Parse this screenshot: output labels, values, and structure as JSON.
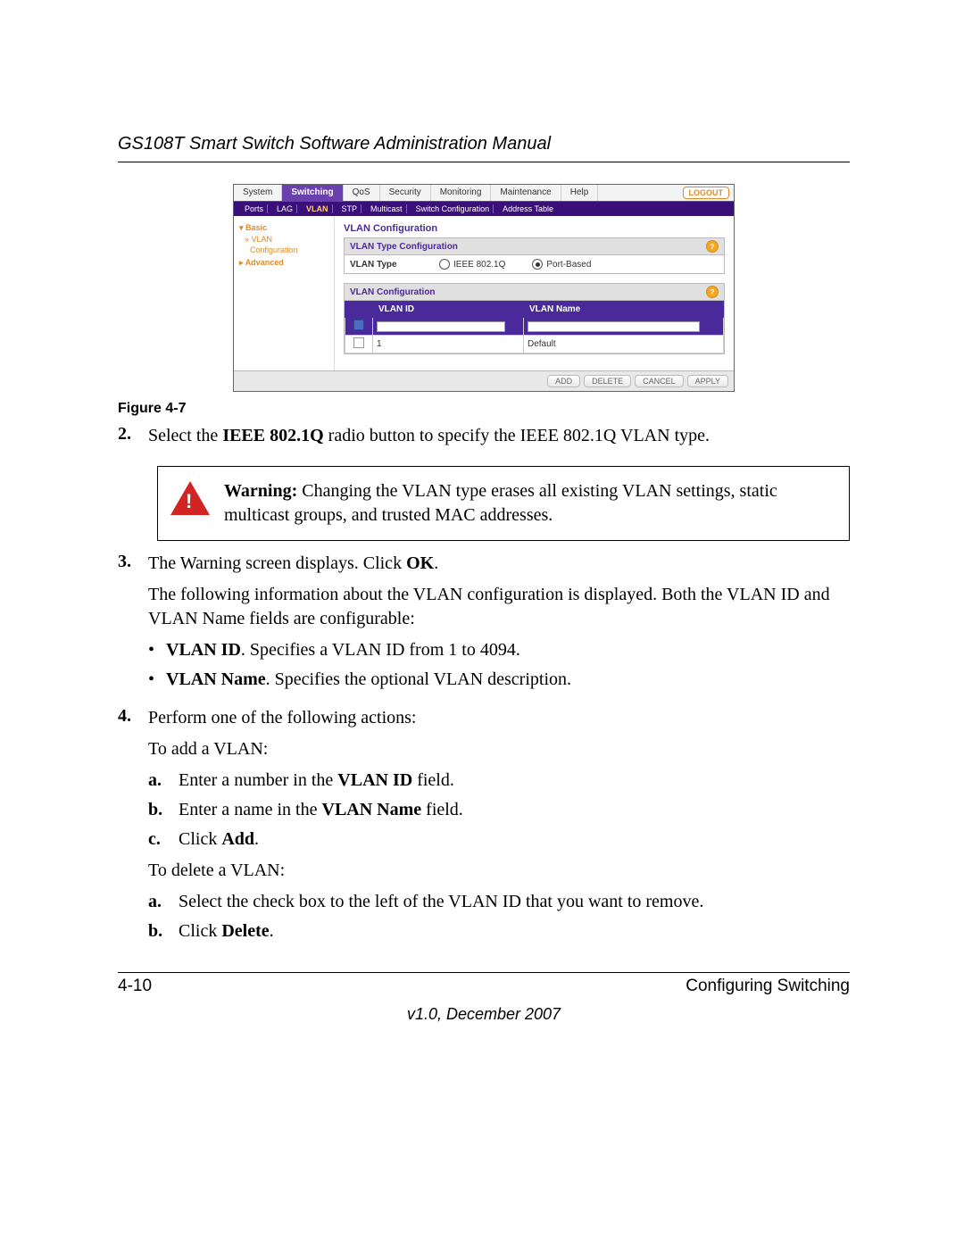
{
  "header": {
    "title": "GS108T Smart Switch Software Administration Manual"
  },
  "figure_caption": "Figure 4-7",
  "ui": {
    "toptabs": [
      "System",
      "Switching",
      "QoS",
      "Security",
      "Monitoring",
      "Maintenance",
      "Help"
    ],
    "toptabs_active_index": 1,
    "logout": "LOGOUT",
    "subtabs": [
      "Ports",
      "LAG",
      "VLAN",
      "STP",
      "Multicast",
      "Switch Configuration",
      "Address Table"
    ],
    "subtabs_active_index": 2,
    "side": {
      "basic": "Basic",
      "vlan": "VLAN",
      "config": "Configuration",
      "advanced": "Advanced"
    },
    "pane_title": "VLAN Configuration",
    "type_box_title": "VLAN Type Configuration",
    "type_label": "VLAN Type",
    "radio_ieee": "IEEE 802.1Q",
    "radio_port": "Port-Based",
    "cfg_box_title": "VLAN Configuration",
    "col_id": "VLAN ID",
    "col_name": "VLAN Name",
    "row_id": "1",
    "row_name": "Default",
    "btn_add": "ADD",
    "btn_delete": "DELETE",
    "btn_cancel": "CANCEL",
    "btn_apply": "APPLY"
  },
  "step2": {
    "num": "2.",
    "prefix": "Select the ",
    "bold": "IEEE 802.1Q",
    "suffix": " radio button to specify the IEEE 802.1Q VLAN type."
  },
  "warning": {
    "label": "Warning:",
    "text": " Changing the VLAN type erases all existing VLAN settings, static multicast groups, and trusted MAC addresses."
  },
  "step3": {
    "num": "3.",
    "line1_prefix": "The Warning screen displays. Click ",
    "line1_bold": "OK",
    "line1_suffix": ".",
    "line2": "The following information about the VLAN configuration is displayed. Both the VLAN ID and VLAN Name fields are configurable:",
    "bullet1_bold": "VLAN ID",
    "bullet1_rest": ". Specifies a VLAN ID from 1 to 4094.",
    "bullet2_bold": "VLAN Name",
    "bullet2_rest": ". Specifies the optional VLAN description."
  },
  "step4": {
    "num": "4.",
    "line1": "Perform one of the following actions:",
    "add_intro": "To add a VLAN:",
    "a": {
      "sn": "a.",
      "prefix": "Enter a number in the ",
      "bold": "VLAN ID",
      "suffix": " field."
    },
    "b": {
      "sn": "b.",
      "prefix": "Enter a name in the ",
      "bold": "VLAN Name",
      "suffix": " field."
    },
    "c": {
      "sn": "c.",
      "prefix": "Click ",
      "bold": "Add",
      "suffix": "."
    },
    "del_intro": "To delete a VLAN:",
    "da": {
      "sn": "a.",
      "text": "Select the check box to the left of the VLAN ID that you want to remove."
    },
    "db": {
      "sn": "b.",
      "prefix": "Click ",
      "bold": "Delete",
      "suffix": "."
    }
  },
  "footer": {
    "page": "4-10",
    "section": "Configuring Switching",
    "version": "v1.0, December 2007"
  }
}
